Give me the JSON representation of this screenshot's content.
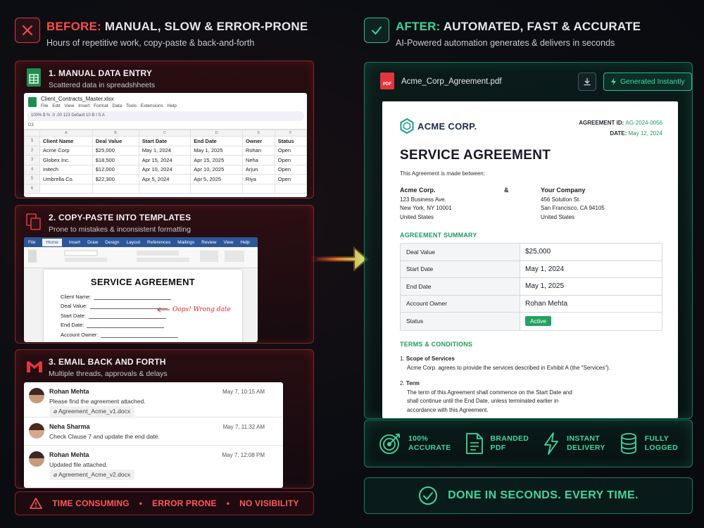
{
  "before": {
    "label": "BEFORE:",
    "title": "MANUAL, SLOW & ERROR-PRONE",
    "subtitle": "Hours of repetitive work, copy-paste & back-and-forth"
  },
  "after": {
    "label": "AFTER:",
    "title": "AUTOMATED, FAST & ACCURATE",
    "subtitle": "AI-Powered automation generates & delivers in seconds"
  },
  "steps": [
    {
      "title": "1. MANUAL DATA ENTRY",
      "subtitle": "Scattered data in spreadshheets"
    },
    {
      "title": "2. COPY-PASTE INTO TEMPLATES",
      "subtitle": "Prone to mistakes & inconsistent formatting"
    },
    {
      "title": "3. EMAIL BACK AND FORTH",
      "subtitle": "Multiple threads, approvals & delays"
    }
  ],
  "sheet": {
    "filename": "Client_Contracts_Master.xlsx",
    "menu": "File  Edit  View  Insert  Format  Data  Tools  Extensions  Help",
    "toolbar": "100%   $  %  .0  .00  123   Default   10   B  I  S  A",
    "cellref": "D3",
    "columns": [
      "A",
      "B",
      "C",
      "D",
      "E",
      "F"
    ],
    "headers": [
      "Client Name",
      "Deal Value",
      "Start Date",
      "End Date",
      "Owner",
      "Status"
    ],
    "rows": [
      [
        "Acme Corp",
        "$25,000",
        "May 1, 2024",
        "May 1, 2025",
        "Rohan",
        "Open"
      ],
      [
        "Globex Inc.",
        "$18,500",
        "Apr 15, 2024",
        "Apr 15, 2025",
        "Neha",
        "Open"
      ],
      [
        "Initech",
        "$12,000",
        "Apr 10, 2024",
        "Apr 10, 2025",
        "Arjun",
        "Open"
      ],
      [
        "Umbrella Co.",
        "$22,300",
        "Apr 5, 2024",
        "Apr 5, 2025",
        "Riya",
        "Open"
      ]
    ],
    "row_numbers": [
      "1",
      "2",
      "3",
      "4",
      "5",
      "6"
    ]
  },
  "word": {
    "tabs": [
      "File",
      "Home",
      "Insert",
      "Draw",
      "Design",
      "Layout",
      "References",
      "Mailings",
      "Review",
      "View",
      "Help"
    ],
    "doc_title": "SERVICE AGREEMENT",
    "fields": [
      "Client Name:",
      "Deal Value:",
      "Start Date:",
      "End Date:",
      "Account Owner:"
    ],
    "annotation": "Oops! Wrong date"
  },
  "emails": [
    {
      "name": "Rohan Mehta",
      "date": "May 7, 10:15 AM",
      "text": "Please find the agreement attached.",
      "attachment": "Agreement_Acme_v1.docx"
    },
    {
      "name": "Neha Sharma",
      "date": "May 7, 11:32 AM",
      "text": "Check Clause 7 and update the end date.",
      "attachment": ""
    },
    {
      "name": "Rohan Mehta",
      "date": "May 7, 12:08 PM",
      "text": "Updated file attached.",
      "attachment": "Agreement_Acme_v2.docx"
    }
  ],
  "warnings": [
    "TIME CONSUMING",
    "ERROR PRONE",
    "NO VISIBILITY"
  ],
  "separator": "•",
  "pdf": {
    "filename": "Acme_Corp_Agreement.pdf",
    "badge": "PDF",
    "generated_label": "Generated Instantly"
  },
  "agreement": {
    "company": "ACME CORP.",
    "id_label": "AGREEMENT ID:",
    "id_value": "AG-2024-0056",
    "date_label": "DATE:",
    "date_value": "May 12, 2024",
    "title": "SERVICE AGREEMENT",
    "intro": "This Agreement is made between:",
    "amp": "&",
    "party1": {
      "name": "Acme Corp.",
      "line1": "123 Business Ave.",
      "line2": "New York, NY 10001",
      "line3": "United States"
    },
    "party2": {
      "name": "Your Company",
      "line1": "456 Solution St.",
      "line2": "San Francisco, CA 94105",
      "line3": "United States"
    },
    "summary_title": "AGREEMENT SUMMARY",
    "summary": [
      {
        "key": "Deal Value",
        "value": "$25,000"
      },
      {
        "key": "Start Date",
        "value": "May 1, 2024"
      },
      {
        "key": "End Date",
        "value": "May 1, 2025"
      },
      {
        "key": "Account Owner",
        "value": "Rohan Mehta"
      },
      {
        "key": "Status",
        "value": "Active"
      }
    ],
    "terms_title": "TERMS & CONDITIONS",
    "terms": [
      {
        "num": "1.",
        "title": "Scope of Services",
        "body": "Acme Corp. agrees to provide the services described in Exhibit A (the \"Services\")."
      },
      {
        "num": "2.",
        "title": "Term",
        "body1": "The term of this Agreement shall commence on the Start Date and",
        "body2": "shall continue until the End Date, unless terminated earlier in",
        "body3": "accordance with this Agreement."
      }
    ]
  },
  "features": [
    {
      "line1": "100%",
      "line2": "ACCURATE",
      "icon": "target-icon"
    },
    {
      "line1": "BRANDED",
      "line2": "PDF",
      "icon": "document-icon"
    },
    {
      "line1": "INSTANT",
      "line2": "DELIVERY",
      "icon": "lightning-icon"
    },
    {
      "line1": "FULLY",
      "line2": "LOGGED",
      "icon": "database-icon"
    }
  ],
  "done": "DONE IN SECONDS. EVERY TIME.",
  "colors": {
    "red": "#ff4b4b",
    "green": "#36d99a",
    "badge_green": "#22a25f"
  }
}
